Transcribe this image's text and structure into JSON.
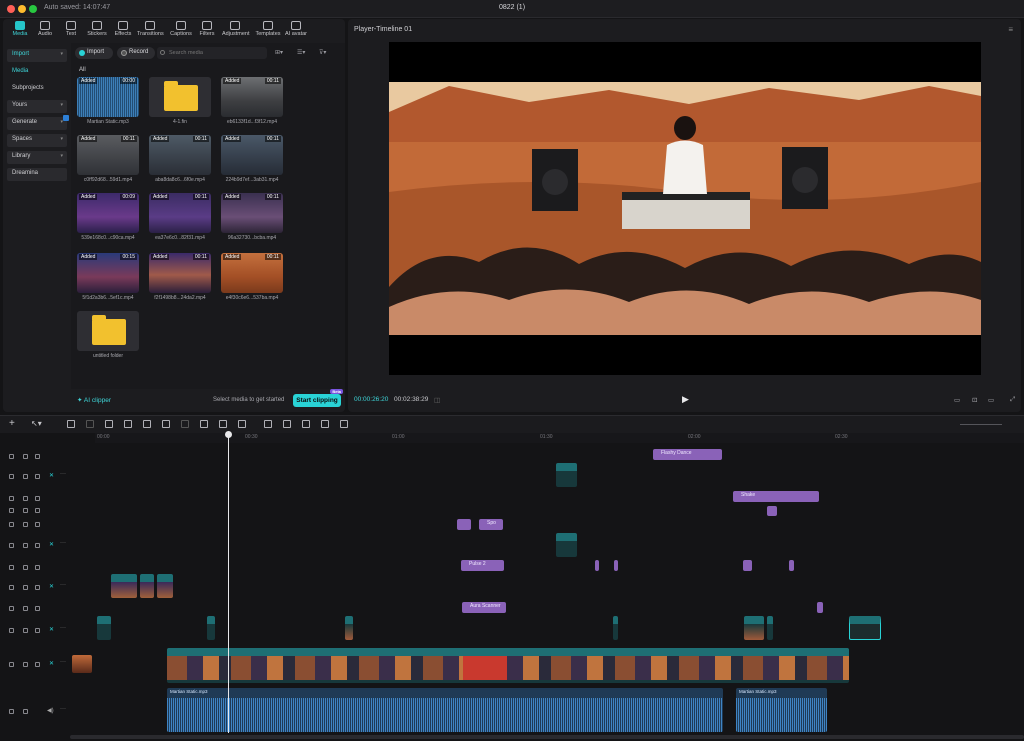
{
  "window": {
    "autosave": "Auto saved: 14:07:47",
    "title": "0822 (1)"
  },
  "toolbar": [
    "Media",
    "Audio",
    "Text",
    "Stickers",
    "Effects",
    "Transitions",
    "Captions",
    "Filters",
    "Adjustment",
    "Templates",
    "AI avatar"
  ],
  "sidenav": {
    "import": "Import",
    "media": "Media",
    "subprojects": "Subprojects",
    "yours": "Yours",
    "generate": "Generate",
    "spaces": "Spaces",
    "library": "Library",
    "dreamina": "Dreamina"
  },
  "media": {
    "import_btn": "Import",
    "record_btn": "Record",
    "search_placeholder": "Search media",
    "all_label": "All",
    "items": [
      {
        "name": "Martian Static.mp3",
        "added": "Added",
        "duration": "00:00"
      },
      {
        "name": "4-1.fin",
        "added": "",
        "duration": ""
      },
      {
        "name": "eb6133f1d...f3f12.mp4",
        "added": "Added",
        "duration": "00:11"
      },
      {
        "name": "c0ff92d68...59d1.mp4",
        "added": "Added",
        "duration": "00:11"
      },
      {
        "name": "aba8da8c6...6f0e.mp4",
        "added": "Added",
        "duration": "00:11"
      },
      {
        "name": "224b9d7ef...3ab31.mp4",
        "added": "Added",
        "duration": "00:11"
      },
      {
        "name": "539e168c0...c90ca.mp4",
        "added": "Added",
        "duration": "00:09"
      },
      {
        "name": "ea37e6c0...82f31.mp4",
        "added": "Added",
        "duration": "00:11"
      },
      {
        "name": "96a32730...bcba.mp4",
        "added": "Added",
        "duration": "00:11"
      },
      {
        "name": "5f1d2a3b6...5ef1c.mp4",
        "added": "Added",
        "duration": "00:15"
      },
      {
        "name": "f2f1498b8...24da2.mp4",
        "added": "Added",
        "duration": "00:11"
      },
      {
        "name": "e4f30c6e6...537ba.mp4",
        "added": "Added",
        "duration": "00:11"
      },
      {
        "name": "untitled folder",
        "added": "",
        "duration": ""
      }
    ],
    "ai_clipper": "AI clipper",
    "select_hint": "Select media to get started",
    "start_clipping": "Start clipping",
    "start_tag": "Beta"
  },
  "player": {
    "title": "Player-Timeline 01",
    "current_time": "00:00:26:20",
    "total_time": "00:02:38:29"
  },
  "timeline": {
    "ruler": [
      "00:00",
      "00:30",
      "01:00",
      "01:30",
      "02:00",
      "02:30"
    ],
    "overlay_clips": [
      "Flashy Dance",
      "Shake",
      "Spo",
      "Pulse 2",
      "Aura Scanner"
    ],
    "audio_name": "Martian Static.mp3",
    "audio_name_2": "Martian Static.mp3"
  },
  "colors": {
    "accent": "#29d3d6",
    "purple_clip": "#8a62b8",
    "teal_clip": "#1e6f74"
  }
}
